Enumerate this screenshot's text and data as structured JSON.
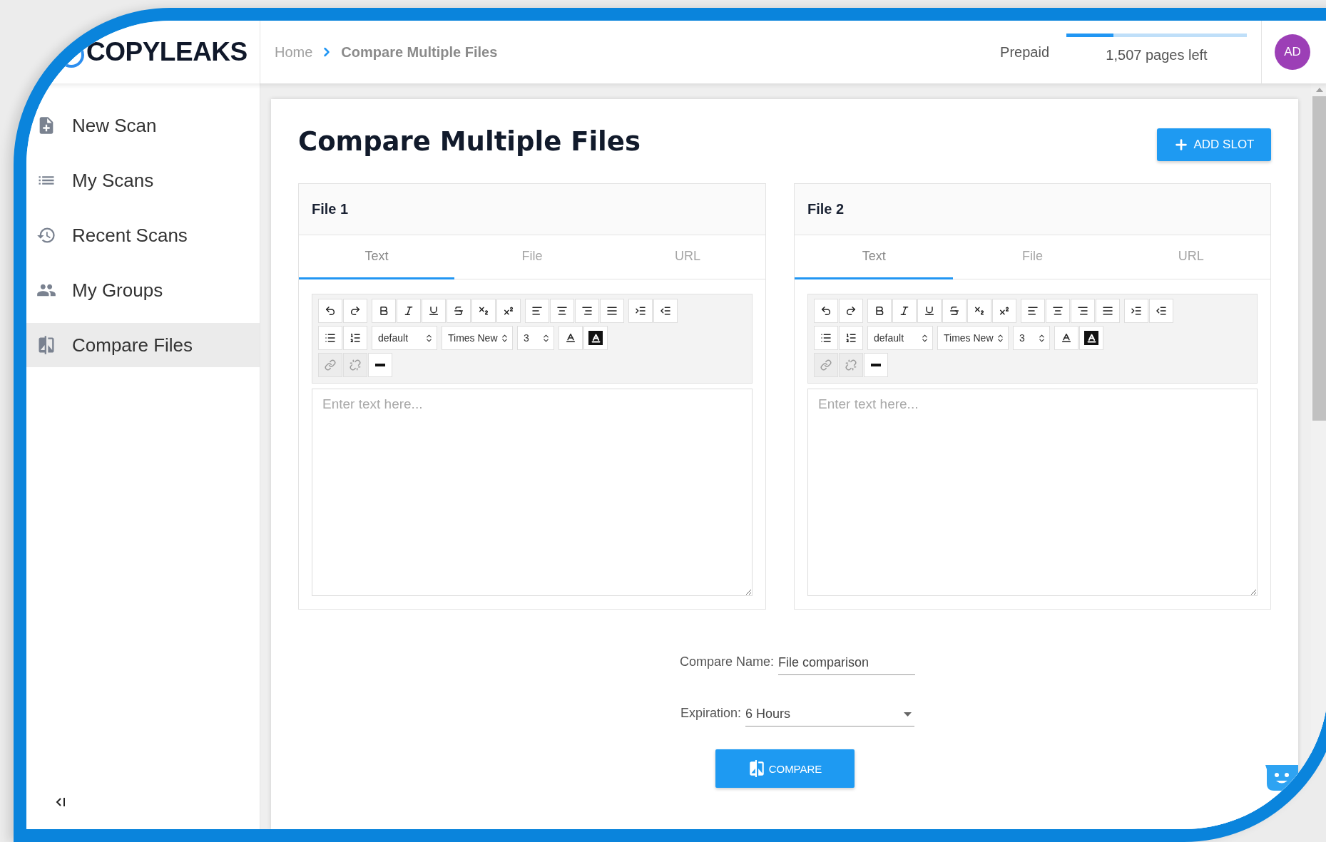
{
  "logo": "COPYLEAKS",
  "breadcrumb": [
    {
      "label": "Home",
      "current": false
    },
    {
      "label": "Compare Multiple Files",
      "current": true
    }
  ],
  "plan": {
    "label": "Prepaid",
    "level": 0.26,
    "pages_left": "1,507 pages left"
  },
  "avatar": "AD",
  "sidebar": {
    "items": [
      {
        "label": "New Scan",
        "kind": "new-scan",
        "selected": false
      },
      {
        "label": "My Scans",
        "kind": "list",
        "selected": false
      },
      {
        "label": "Recent Scans",
        "kind": "history",
        "selected": false
      },
      {
        "label": "My Groups",
        "kind": "groups",
        "selected": false
      },
      {
        "label": "Compare Files",
        "kind": "compare",
        "selected": true
      }
    ]
  },
  "page_title": "Compare Multiple Files",
  "add_slot_button": "ADD SLOT",
  "files": [
    {
      "title": "File 1",
      "tabs": [
        {
          "label": "Text",
          "selected": true
        },
        {
          "label": "File",
          "selected": false
        },
        {
          "label": "URL",
          "selected": false
        }
      ],
      "toolbar": [
        [
          [
            {
              "kind": "undo",
              "disabled": false
            },
            {
              "kind": "redo",
              "disabled": false
            }
          ],
          [
            {
              "kind": "bold",
              "disabled": false
            },
            {
              "kind": "italic",
              "disabled": false
            },
            {
              "kind": "underline",
              "disabled": false
            },
            {
              "kind": "strike",
              "disabled": false
            },
            {
              "kind": "subscript",
              "disabled": false
            },
            {
              "kind": "superscript",
              "disabled": false
            }
          ],
          [
            {
              "kind": "align-left",
              "disabled": false
            },
            {
              "kind": "align-center",
              "disabled": false
            },
            {
              "kind": "align-right",
              "disabled": false
            },
            {
              "kind": "justify",
              "disabled": false
            }
          ],
          [
            {
              "kind": "indent",
              "disabled": false
            },
            {
              "kind": "outdent",
              "disabled": false
            }
          ]
        ],
        [
          [
            {
              "kind": "bullets",
              "disabled": false
            },
            {
              "kind": "numbers",
              "disabled": false
            }
          ],
          [
            {
              "kind": "select",
              "value": "default",
              "disabled": false
            }
          ],
          [
            {
              "kind": "select",
              "value": "Times New",
              "disabled": false
            }
          ],
          [
            {
              "kind": "select",
              "value": "3",
              "disabled": false
            }
          ],
          [
            {
              "kind": "fore-color",
              "disabled": false
            },
            {
              "kind": "back-color",
              "disabled": false
            }
          ]
        ],
        [
          [
            {
              "kind": "link",
              "disabled": true
            },
            {
              "kind": "unlink",
              "disabled": true
            },
            {
              "kind": "rule",
              "disabled": false
            }
          ]
        ]
      ],
      "placeholder": "Enter text here..."
    },
    {
      "title": "File 2",
      "tabs": [
        {
          "label": "Text",
          "selected": true
        },
        {
          "label": "File",
          "selected": false
        },
        {
          "label": "URL",
          "selected": false
        }
      ],
      "toolbar": [
        [
          [
            {
              "kind": "undo",
              "disabled": false
            },
            {
              "kind": "redo",
              "disabled": false
            }
          ],
          [
            {
              "kind": "bold",
              "disabled": false
            },
            {
              "kind": "italic",
              "disabled": false
            },
            {
              "kind": "underline",
              "disabled": false
            },
            {
              "kind": "strike",
              "disabled": false
            },
            {
              "kind": "subscript",
              "disabled": false
            },
            {
              "kind": "superscript",
              "disabled": false
            }
          ],
          [
            {
              "kind": "align-left",
              "disabled": false
            },
            {
              "kind": "align-center",
              "disabled": false
            },
            {
              "kind": "align-right",
              "disabled": false
            },
            {
              "kind": "justify",
              "disabled": false
            }
          ],
          [
            {
              "kind": "indent",
              "disabled": false
            },
            {
              "kind": "outdent",
              "disabled": false
            }
          ]
        ],
        [
          [
            {
              "kind": "bullets",
              "disabled": false
            },
            {
              "kind": "numbers",
              "disabled": false
            }
          ],
          [
            {
              "kind": "select",
              "value": "default",
              "disabled": false
            }
          ],
          [
            {
              "kind": "select",
              "value": "Times New",
              "disabled": false
            }
          ],
          [
            {
              "kind": "select",
              "value": "3",
              "disabled": false
            }
          ],
          [
            {
              "kind": "fore-color",
              "disabled": false
            },
            {
              "kind": "back-color",
              "disabled": false
            }
          ]
        ],
        [
          [
            {
              "kind": "link",
              "disabled": true
            },
            {
              "kind": "unlink",
              "disabled": true
            },
            {
              "kind": "rule",
              "disabled": false
            }
          ]
        ]
      ],
      "placeholder": "Enter text here..."
    }
  ],
  "compare_name": {
    "label": "Compare Name:",
    "value": "File comparison"
  },
  "expiration": {
    "label": "Expiration:",
    "value": "6 Hours"
  },
  "compare_button": "COMPARE"
}
